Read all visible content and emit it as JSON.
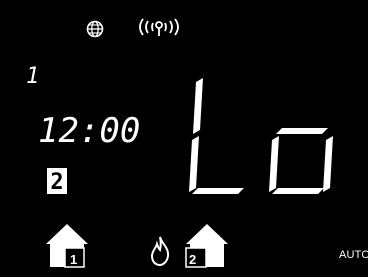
{
  "display": {
    "zone_number": "1",
    "time": "12:00",
    "setpoint": "Lo",
    "secondary_zone": "2",
    "mode": "AUTO"
  },
  "icons": {
    "top": [
      "globe-icon",
      "antenna-icon"
    ],
    "bottom": [
      "house-icon",
      "flame-icon",
      "house-icon"
    ]
  },
  "houses": [
    {
      "label": "1"
    },
    {
      "label": "2"
    }
  ],
  "colors": {
    "background": "#000000",
    "foreground": "#ffffff"
  }
}
